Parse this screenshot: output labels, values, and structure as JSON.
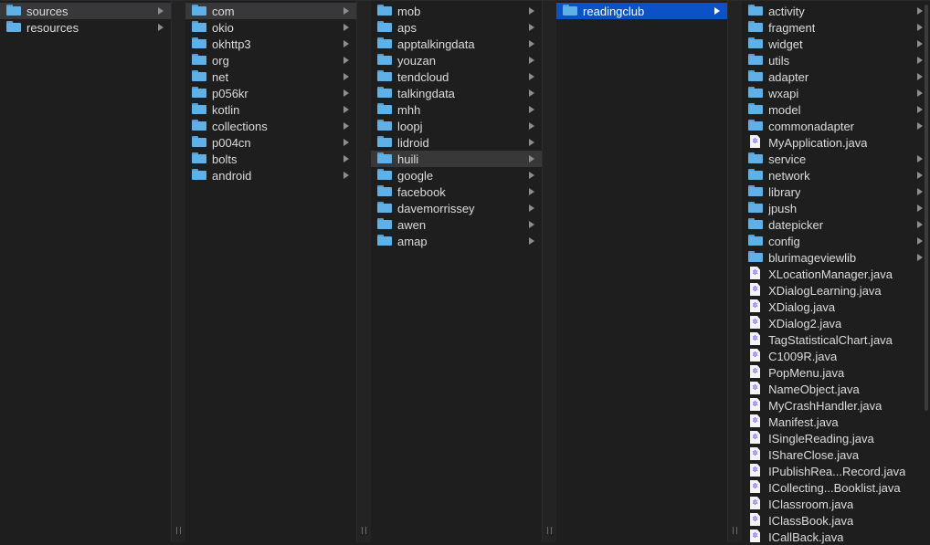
{
  "columns": [
    {
      "items": [
        {
          "name": "sources",
          "type": "folder",
          "arrow": true,
          "state": "inactive"
        },
        {
          "name": "resources",
          "type": "folder",
          "arrow": true
        }
      ]
    },
    {
      "items": [
        {
          "name": "com",
          "type": "folder",
          "arrow": true,
          "state": "inactive"
        },
        {
          "name": "okio",
          "type": "folder",
          "arrow": true
        },
        {
          "name": "okhttp3",
          "type": "folder",
          "arrow": true
        },
        {
          "name": "org",
          "type": "folder",
          "arrow": true
        },
        {
          "name": "net",
          "type": "folder",
          "arrow": true
        },
        {
          "name": "p056kr",
          "type": "folder",
          "arrow": true
        },
        {
          "name": "kotlin",
          "type": "folder",
          "arrow": true
        },
        {
          "name": "collections",
          "type": "folder",
          "arrow": true
        },
        {
          "name": "p004cn",
          "type": "folder",
          "arrow": true
        },
        {
          "name": "bolts",
          "type": "folder",
          "arrow": true
        },
        {
          "name": "android",
          "type": "folder",
          "arrow": true
        }
      ]
    },
    {
      "items": [
        {
          "name": "mob",
          "type": "folder",
          "arrow": true
        },
        {
          "name": "aps",
          "type": "folder",
          "arrow": true
        },
        {
          "name": "apptalkingdata",
          "type": "folder",
          "arrow": true
        },
        {
          "name": "youzan",
          "type": "folder",
          "arrow": true
        },
        {
          "name": "tendcloud",
          "type": "folder",
          "arrow": true
        },
        {
          "name": "talkingdata",
          "type": "folder",
          "arrow": true
        },
        {
          "name": "mhh",
          "type": "folder",
          "arrow": true
        },
        {
          "name": "loopj",
          "type": "folder",
          "arrow": true
        },
        {
          "name": "lidroid",
          "type": "folder",
          "arrow": true
        },
        {
          "name": "huili",
          "type": "folder",
          "arrow": true,
          "state": "inactive"
        },
        {
          "name": "google",
          "type": "folder",
          "arrow": true
        },
        {
          "name": "facebook",
          "type": "folder",
          "arrow": true
        },
        {
          "name": "davemorrissey",
          "type": "folder",
          "arrow": true
        },
        {
          "name": "awen",
          "type": "folder",
          "arrow": true
        },
        {
          "name": "amap",
          "type": "folder",
          "arrow": true
        }
      ]
    },
    {
      "items": [
        {
          "name": "readingclub",
          "type": "folder",
          "arrow": true,
          "state": "active"
        }
      ]
    },
    {
      "items": [
        {
          "name": "activity",
          "type": "folder",
          "arrow": true
        },
        {
          "name": "fragment",
          "type": "folder",
          "arrow": true
        },
        {
          "name": "widget",
          "type": "folder",
          "arrow": true
        },
        {
          "name": "utils",
          "type": "folder",
          "arrow": true
        },
        {
          "name": "adapter",
          "type": "folder",
          "arrow": true
        },
        {
          "name": "wxapi",
          "type": "folder",
          "arrow": true
        },
        {
          "name": "model",
          "type": "folder",
          "arrow": true
        },
        {
          "name": "commonadapter",
          "type": "folder",
          "arrow": true
        },
        {
          "name": "MyApplication.java",
          "type": "file",
          "arrow": false
        },
        {
          "name": "service",
          "type": "folder",
          "arrow": true
        },
        {
          "name": "network",
          "type": "folder",
          "arrow": true
        },
        {
          "name": "library",
          "type": "folder",
          "arrow": true
        },
        {
          "name": "jpush",
          "type": "folder",
          "arrow": true
        },
        {
          "name": "datepicker",
          "type": "folder",
          "arrow": true
        },
        {
          "name": "config",
          "type": "folder",
          "arrow": true
        },
        {
          "name": "blurimageviewlib",
          "type": "folder",
          "arrow": true
        },
        {
          "name": "XLocationManager.java",
          "type": "file",
          "arrow": false
        },
        {
          "name": "XDialogLearning.java",
          "type": "file",
          "arrow": false
        },
        {
          "name": "XDialog.java",
          "type": "file",
          "arrow": false
        },
        {
          "name": "XDialog2.java",
          "type": "file",
          "arrow": false
        },
        {
          "name": "TagStatisticalChart.java",
          "type": "file",
          "arrow": false
        },
        {
          "name": "C1009R.java",
          "type": "file",
          "arrow": false
        },
        {
          "name": "PopMenu.java",
          "type": "file",
          "arrow": false
        },
        {
          "name": "NameObject.java",
          "type": "file",
          "arrow": false
        },
        {
          "name": "MyCrashHandler.java",
          "type": "file",
          "arrow": false
        },
        {
          "name": "Manifest.java",
          "type": "file",
          "arrow": false
        },
        {
          "name": "ISingleReading.java",
          "type": "file",
          "arrow": false
        },
        {
          "name": "IShareClose.java",
          "type": "file",
          "arrow": false
        },
        {
          "name": "IPublishRea...Record.java",
          "type": "file",
          "arrow": false
        },
        {
          "name": "ICollecting...Booklist.java",
          "type": "file",
          "arrow": false
        },
        {
          "name": "IClassroom.java",
          "type": "file",
          "arrow": false
        },
        {
          "name": "IClassBook.java",
          "type": "file",
          "arrow": false
        },
        {
          "name": "ICallBack.java",
          "type": "file",
          "arrow": false
        }
      ]
    }
  ],
  "colors": {
    "selection_active": "#0a52c6",
    "selection_inactive": "#38383a",
    "folder": "#5fb0e6",
    "background": "#1e1e1f"
  }
}
